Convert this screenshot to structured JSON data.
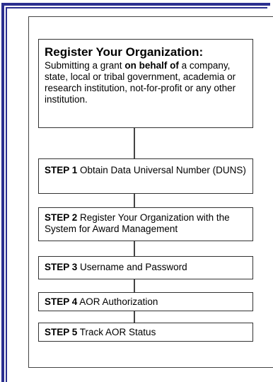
{
  "header": {
    "title": "Register Your Organization:",
    "line_prefix": "Submitting a grant ",
    "line_bold": "on behalf of",
    "line_suffix": " a company, state, local or tribal government, academia or research institution, not-for-profit or any other institution."
  },
  "steps": [
    {
      "label": "STEP 1",
      "text": " Obtain Data Universal Number (DUNS)"
    },
    {
      "label": "STEP 2",
      "text": " Register Your Organization with the System for Award Management"
    },
    {
      "label": "STEP 3",
      "text": " Username and Password"
    },
    {
      "label": "STEP 4",
      "text": " AOR Authorization"
    },
    {
      "label": "STEP 5",
      "text": " Track AOR Status"
    }
  ],
  "colors": {
    "frame": "#2b2f8f",
    "box_border": "#333333"
  }
}
